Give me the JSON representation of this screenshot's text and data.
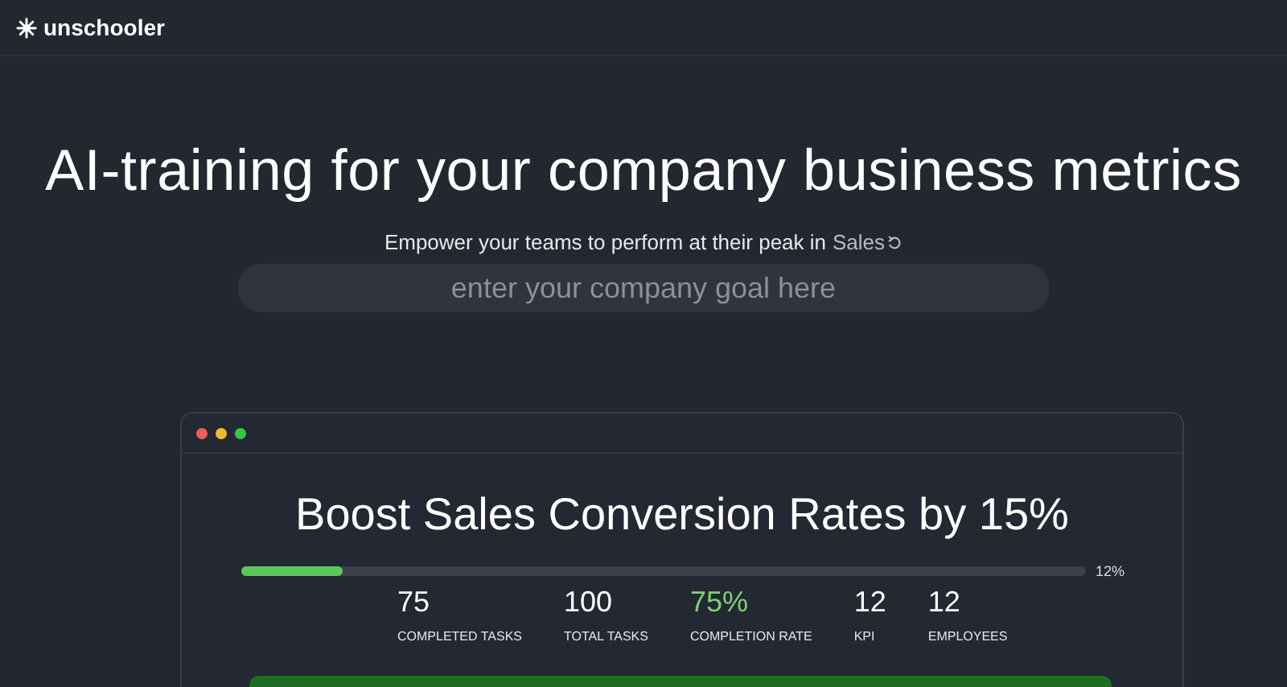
{
  "header": {
    "logo_text": "unschooler"
  },
  "hero": {
    "headline": "AI-training for your company business metrics",
    "subtitle": "Empower your teams to perform at their peak in",
    "subtitle_link": "Sales",
    "goal_field": {
      "placeholder": "enter your company goal here"
    }
  },
  "card": {
    "title": "Boost Sales Conversion Rates by 15%",
    "progress": {
      "level": 0.12,
      "reading": "12%"
    },
    "stats": [
      {
        "value": "75",
        "label": "COMPLETED TASKS",
        "color": "#ffffff"
      },
      {
        "value": "100",
        "label": "TOTAL TASKS",
        "color": "#ffffff"
      },
      {
        "value": "75%",
        "label": "COMPLETION RATE",
        "color": "#7ed36f"
      },
      {
        "value": "12",
        "label": "KPI",
        "color": "#ffffff"
      },
      {
        "value": "12",
        "label": "EMPLOYEES",
        "color": "#ffffff"
      }
    ]
  }
}
